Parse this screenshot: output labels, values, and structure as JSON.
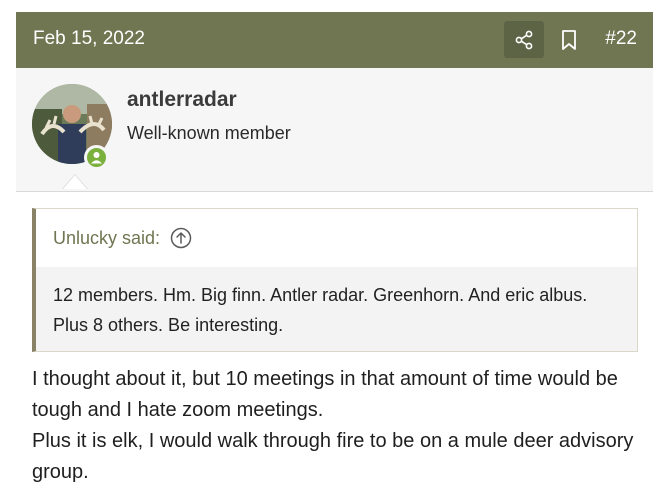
{
  "header": {
    "date": "Feb 15, 2022",
    "post_number": "#22",
    "background": "#6f7651"
  },
  "author": {
    "username": "antlerradar",
    "title": "Well-known member",
    "status": "online"
  },
  "quote": {
    "attribution": "Unlucky said:",
    "text": "12 members. Hm. Big finn. Antler radar. Greenhorn. And eric albus. Plus 8 others. Be interesting."
  },
  "post": {
    "line1": "I thought about it, but 10 meetings in that amount of time would be tough and I hate zoom meetings.",
    "line2": "Plus it is elk, I would walk through fire to be on a mule deer advisory group."
  },
  "icons": [
    "share-icon",
    "bookmark-icon",
    "user-icon",
    "arrow-up-circle-icon"
  ]
}
